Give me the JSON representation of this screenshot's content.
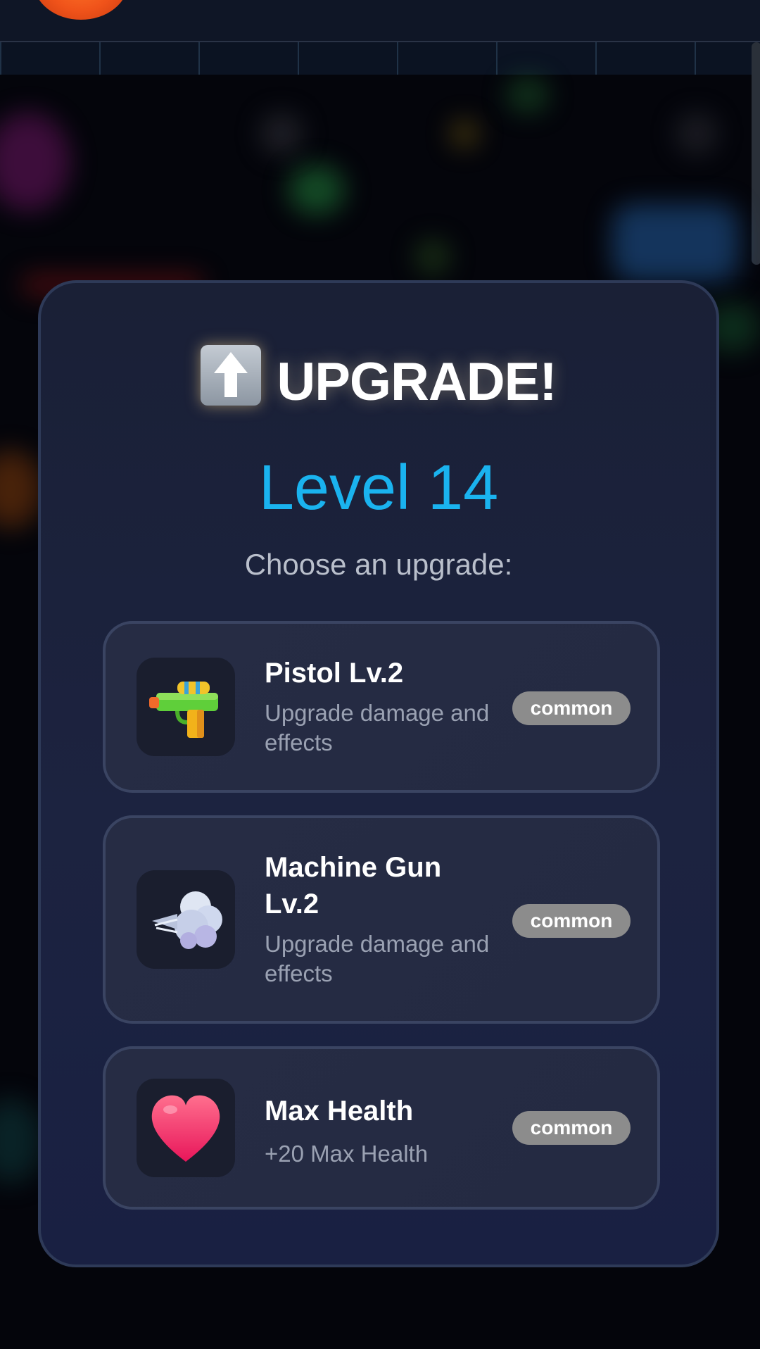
{
  "modal": {
    "title": "UPGRADE!",
    "title_icon": "up-arrow-icon",
    "level": "Level 14",
    "prompt": "Choose an upgrade:"
  },
  "options": [
    {
      "icon": "water-pistol-icon",
      "name": "Pistol Lv.2",
      "description": "Upgrade damage and effects",
      "rarity": "common"
    },
    {
      "icon": "wind-puff-icon",
      "name": "Machine Gun Lv.2",
      "description": "Upgrade damage and effects",
      "rarity": "common"
    },
    {
      "icon": "heart-icon",
      "name": "Max Health",
      "description": "+20 Max Health",
      "rarity": "common"
    }
  ],
  "colors": {
    "level_accent": "#1ab3ef",
    "badge_common": "#8c8c8c",
    "modal_bg": "#1c2340",
    "player_orb": "#f0531a"
  }
}
